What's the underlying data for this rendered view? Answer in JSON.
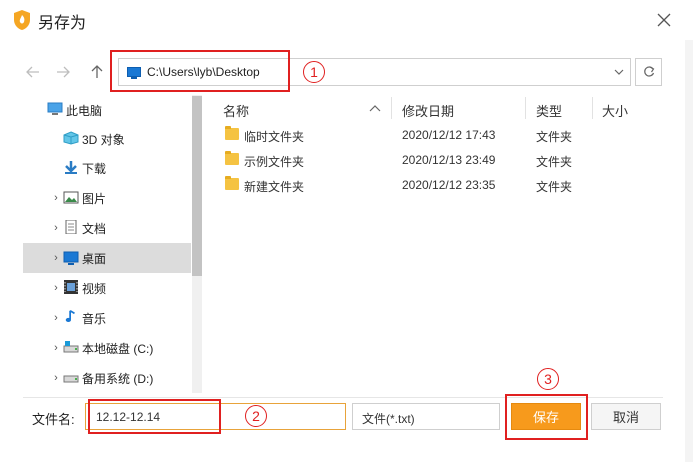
{
  "window": {
    "title": "另存为"
  },
  "address": {
    "path": "C:\\Users\\lyb\\Desktop"
  },
  "tree": {
    "items": [
      {
        "label": "此电脑",
        "icon": "computer-icon"
      },
      {
        "label": "3D 对象",
        "icon": "3d-objects-icon"
      },
      {
        "label": "下载",
        "icon": "download-icon"
      },
      {
        "label": "图片",
        "icon": "pictures-icon"
      },
      {
        "label": "文档",
        "icon": "documents-icon"
      },
      {
        "label": "桌面",
        "icon": "desktop-icon",
        "selected": true
      },
      {
        "label": "视频",
        "icon": "videos-icon"
      },
      {
        "label": "音乐",
        "icon": "music-icon"
      },
      {
        "label": "本地磁盘 (C:)",
        "icon": "drive-icon"
      },
      {
        "label": "备用系统 (D:)",
        "icon": "drive-icon"
      }
    ]
  },
  "list": {
    "headers": {
      "name": "名称",
      "modified": "修改日期",
      "type": "类型",
      "size": "大小"
    },
    "rows": [
      {
        "name": "临时文件夹",
        "modified": "2020/12/12 17:43",
        "type": "文件夹"
      },
      {
        "name": "示例文件夹",
        "modified": "2020/12/13 23:49",
        "type": "文件夹"
      },
      {
        "name": "新建文件夹",
        "modified": "2020/12/12 23:35",
        "type": "文件夹"
      }
    ]
  },
  "bottom": {
    "filename_label": "文件名:",
    "filename_value": "12.12-12.14",
    "filetype": "文件(*.txt)",
    "save_label": "保存",
    "cancel_label": "取消"
  },
  "annotations": {
    "step1": "1",
    "step2": "2",
    "step3": "3"
  },
  "colors": {
    "accent": "#f79a1c",
    "annotation": "#e02020",
    "selection": "#dcdcdc",
    "folder": "#f5c342"
  }
}
